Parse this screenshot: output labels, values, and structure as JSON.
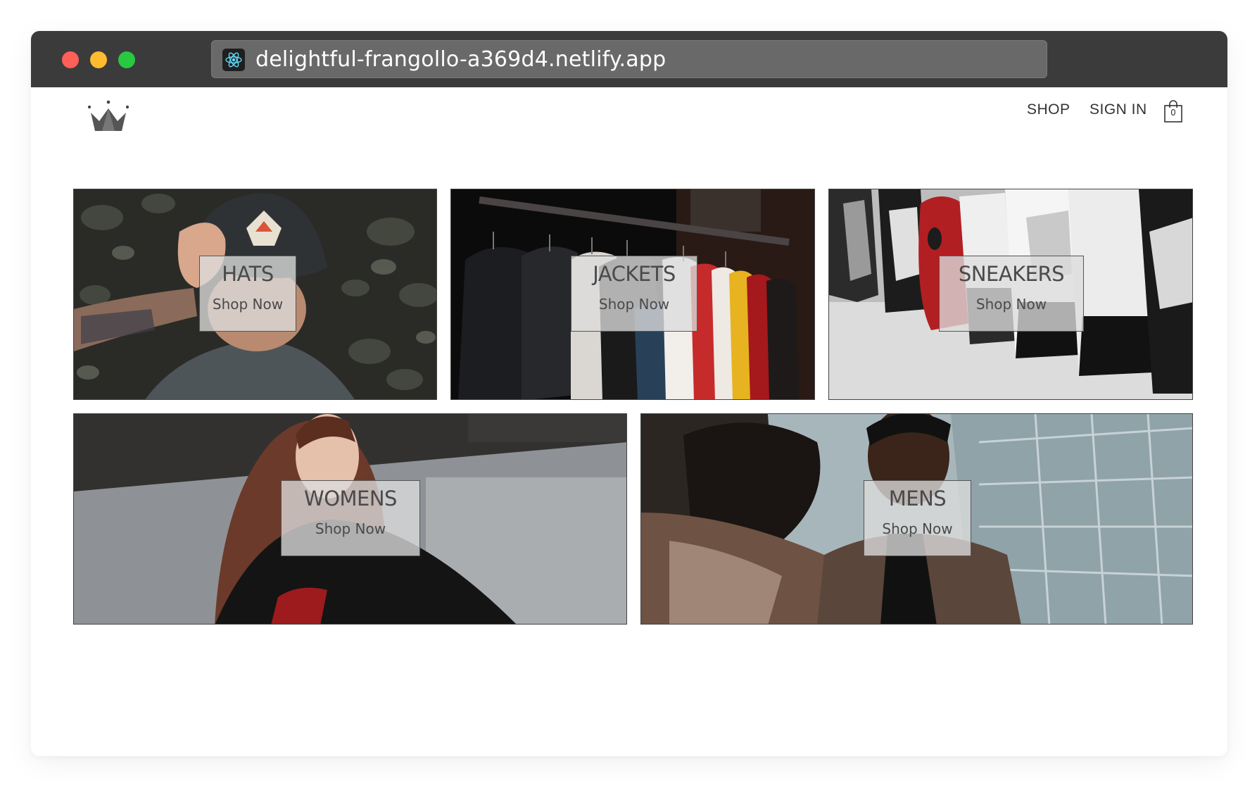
{
  "browser": {
    "url": "delightful-frangollo-a369d4.netlify.app",
    "favicon": "react-icon"
  },
  "header": {
    "logo": "crown-icon",
    "nav": [
      {
        "label": "SHOP"
      },
      {
        "label": "SIGN IN"
      }
    ],
    "cart": {
      "icon": "shopping-bag-icon",
      "count": "0"
    }
  },
  "directory": [
    {
      "title": "HATS",
      "subtitle": "Shop Now"
    },
    {
      "title": "JACKETS",
      "subtitle": "Shop Now"
    },
    {
      "title": "SNEAKERS",
      "subtitle": "Shop Now"
    },
    {
      "title": "WOMENS",
      "subtitle": "Shop Now"
    },
    {
      "title": "MENS",
      "subtitle": "Shop Now"
    }
  ],
  "colors": {
    "titlebar": "#3b3b3b",
    "urlbar": "#696969",
    "traffic_red": "#fe5f57",
    "traffic_yellow": "#febc2e",
    "traffic_green": "#28c840",
    "text": "#333333"
  }
}
